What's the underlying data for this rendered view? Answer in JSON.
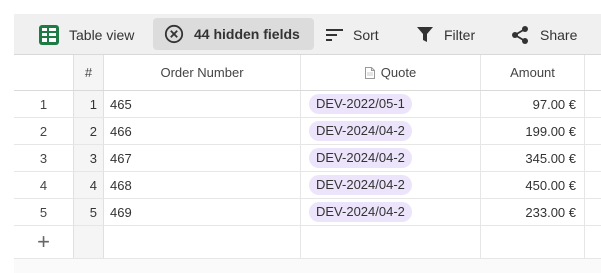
{
  "toolbar": {
    "table_view_label": "Table view",
    "hidden_fields_label": "44 hidden fields",
    "sort_label": "Sort",
    "filter_label": "Filter",
    "share_label": "Share"
  },
  "table": {
    "headers": {
      "index": "#",
      "order_number": "Order Number",
      "quote": "Quote",
      "amount": "Amount"
    },
    "rows": [
      {
        "row_num": "1",
        "index": "1",
        "order_number": "465",
        "quote": "DEV-2022/05-1",
        "amount": "97.00 €"
      },
      {
        "row_num": "2",
        "index": "2",
        "order_number": "466",
        "quote": "DEV-2024/04-2",
        "amount": "199.00 €"
      },
      {
        "row_num": "3",
        "index": "3",
        "order_number": "467",
        "quote": "DEV-2024/04-2",
        "amount": "345.00 €"
      },
      {
        "row_num": "4",
        "index": "4",
        "order_number": "468",
        "quote": "DEV-2024/04-2",
        "amount": "450.00 €"
      },
      {
        "row_num": "5",
        "index": "5",
        "order_number": "469",
        "quote": "DEV-2024/04-2",
        "amount": "233.00 €"
      }
    ],
    "add_row_symbol": "+"
  },
  "colors": {
    "toolbar_bg": "#f0f0f0",
    "hidden_fields_bg": "#dcdcdc",
    "chip_bg": "#ece4fa",
    "table_view_icon": "#1e7b45"
  },
  "icons": {
    "table_view": "table-grid-icon",
    "hidden_fields": "circle-x-icon",
    "sort": "sort-lines-icon",
    "filter": "funnel-icon",
    "share": "share-nodes-icon",
    "quote_header": "document-icon"
  }
}
